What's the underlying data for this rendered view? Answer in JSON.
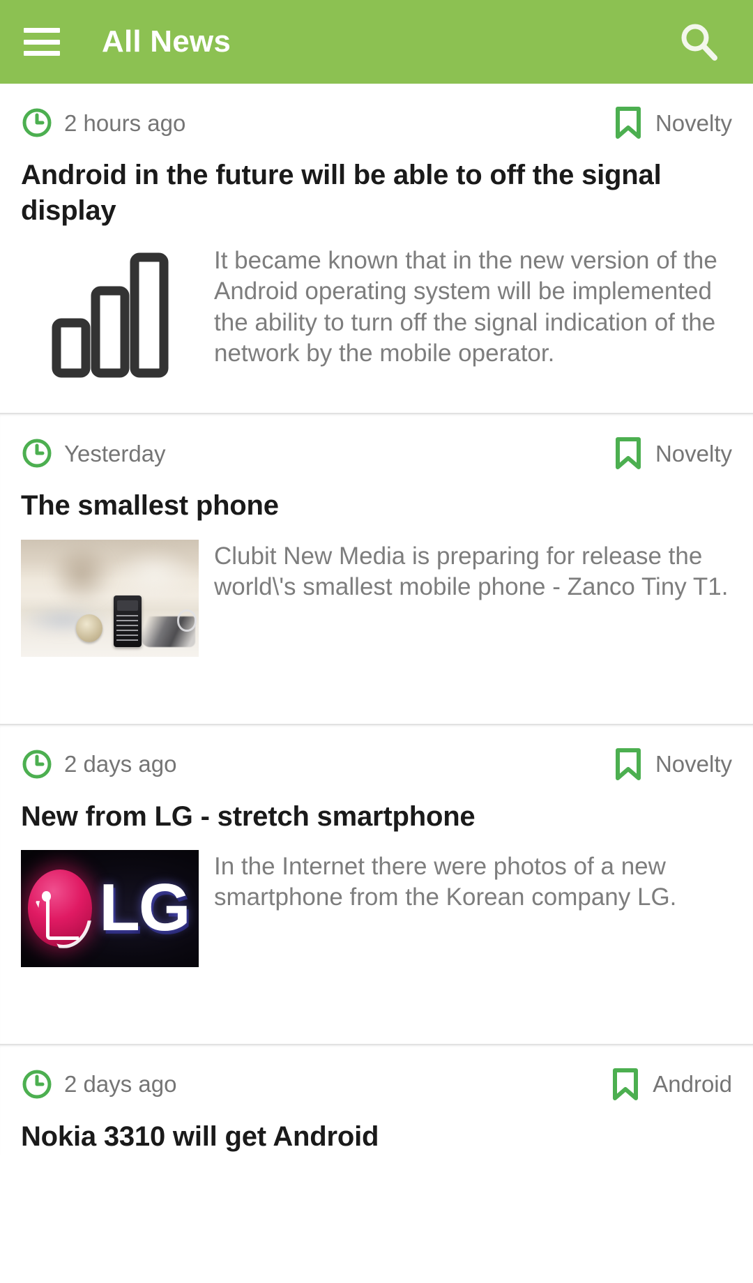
{
  "appbar": {
    "menu_icon": "hamburger-menu-icon",
    "title": "All News",
    "search_icon": "search-icon",
    "background_color": "#8CC152",
    "text_color": "#FFFFFF"
  },
  "theme": {
    "accent_green": "#4CAF50",
    "body_text_color": "#7D7D7D",
    "title_text_color": "#1A1A1A",
    "divider_color": "#E2E2E2"
  },
  "feed": {
    "articles": [
      {
        "time": "2 hours ago",
        "time_icon": "clock-icon",
        "category": "Novelty",
        "category_icon": "bookmark-icon",
        "title": "Android in the future will be able to off the signal display",
        "text": "It became known that in the new version of the Android operating system will be implemented the ability to turn off the signal indication of the network by the mobile operator.",
        "thumbnail": "signal-bars-icon"
      },
      {
        "time": "Yesterday",
        "time_icon": "clock-icon",
        "category": "Novelty",
        "category_icon": "bookmark-icon",
        "title": "The smallest phone",
        "text": "Clubit New Media is preparing for release the world\\'s smallest mobile phone - Zanco Tiny T1.",
        "thumbnail": "tiny-phone-photo"
      },
      {
        "time": "2 days ago",
        "time_icon": "clock-icon",
        "category": "Novelty",
        "category_icon": "bookmark-icon",
        "title": "New from LG - stretch smartphone",
        "text": "In the Internet there were photos of a new smartphone from the Korean company LG.",
        "thumbnail": "lg-logo-photo",
        "thumbnail_text": "LG"
      },
      {
        "time": "2 days ago",
        "time_icon": "clock-icon",
        "category": "Android",
        "category_icon": "bookmark-icon",
        "title": "Nokia 3310 will get Android",
        "text": "",
        "thumbnail": ""
      }
    ]
  }
}
